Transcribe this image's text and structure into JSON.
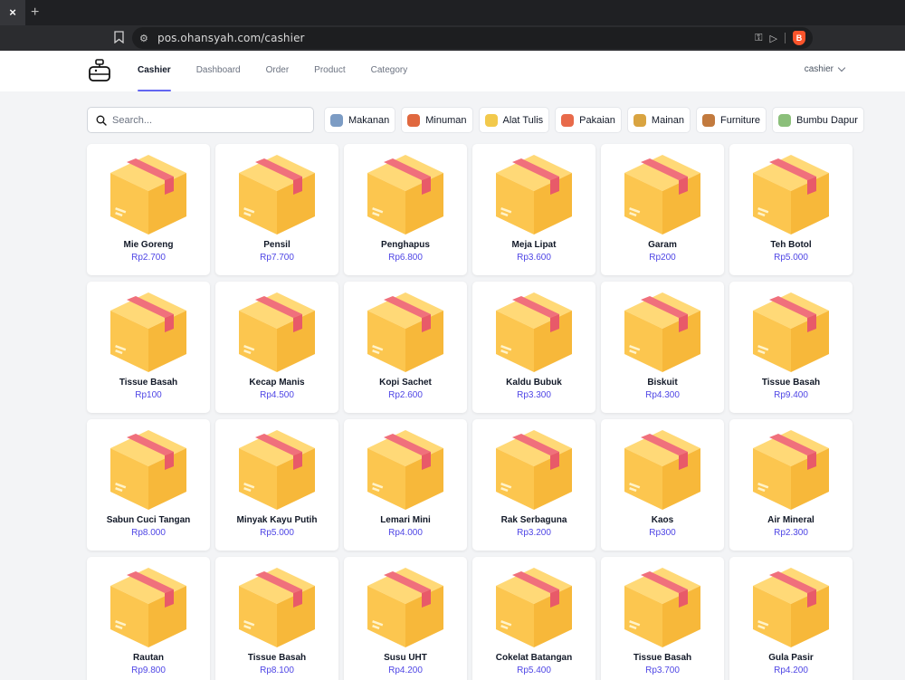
{
  "browser": {
    "close_tab": "×",
    "new_tab": "+",
    "url": "pos.ohansyah.com/cashier"
  },
  "header": {
    "nav": [
      "Cashier",
      "Dashboard",
      "Order",
      "Product",
      "Category"
    ],
    "active_nav": "Cashier",
    "user": "cashier"
  },
  "search": {
    "placeholder": "Search..."
  },
  "categories": [
    {
      "label": "Makanan",
      "icon": "food-icon",
      "color": "#7c9cc4"
    },
    {
      "label": "Minuman",
      "icon": "drink-icon",
      "color": "#e0683f"
    },
    {
      "label": "Alat Tulis",
      "icon": "stationery-icon",
      "color": "#f2c94c"
    },
    {
      "label": "Pakaian",
      "icon": "clothes-icon",
      "color": "#e86a4a"
    },
    {
      "label": "Mainan",
      "icon": "toy-icon",
      "color": "#d9a441"
    },
    {
      "label": "Furniture",
      "icon": "furniture-icon",
      "color": "#c27a3e"
    },
    {
      "label": "Bumbu Dapur",
      "icon": "spice-icon",
      "color": "#8bbf7a"
    }
  ],
  "colors": {
    "accent": "#6366f1",
    "price": "#4f46e5",
    "box_body": "#fcc64f",
    "box_tape": "#f0707c"
  },
  "products": [
    {
      "name": "Mie Goreng",
      "price": "Rp2.700"
    },
    {
      "name": "Pensil",
      "price": "Rp7.700"
    },
    {
      "name": "Penghapus",
      "price": "Rp6.800"
    },
    {
      "name": "Meja Lipat",
      "price": "Rp3.600"
    },
    {
      "name": "Garam",
      "price": "Rp200"
    },
    {
      "name": "Teh Botol",
      "price": "Rp5.000"
    },
    {
      "name": "Tissue Basah",
      "price": "Rp100"
    },
    {
      "name": "Kecap Manis",
      "price": "Rp4.500"
    },
    {
      "name": "Kopi Sachet",
      "price": "Rp2.600"
    },
    {
      "name": "Kaldu Bubuk",
      "price": "Rp3.300"
    },
    {
      "name": "Biskuit",
      "price": "Rp4.300"
    },
    {
      "name": "Tissue Basah",
      "price": "Rp9.400"
    },
    {
      "name": "Sabun Cuci Tangan",
      "price": "Rp8.000"
    },
    {
      "name": "Minyak Kayu Putih",
      "price": "Rp5.000"
    },
    {
      "name": "Lemari Mini",
      "price": "Rp4.000"
    },
    {
      "name": "Rak Serbaguna",
      "price": "Rp3.200"
    },
    {
      "name": "Kaos",
      "price": "Rp300"
    },
    {
      "name": "Air Mineral",
      "price": "Rp2.300"
    },
    {
      "name": "Rautan",
      "price": "Rp9.800"
    },
    {
      "name": "Tissue Basah",
      "price": "Rp8.100"
    },
    {
      "name": "Susu UHT",
      "price": "Rp4.200"
    },
    {
      "name": "Cokelat Batangan",
      "price": "Rp5.400"
    },
    {
      "name": "Tissue Basah",
      "price": "Rp3.700"
    },
    {
      "name": "Gula Pasir",
      "price": "Rp4.200"
    }
  ]
}
